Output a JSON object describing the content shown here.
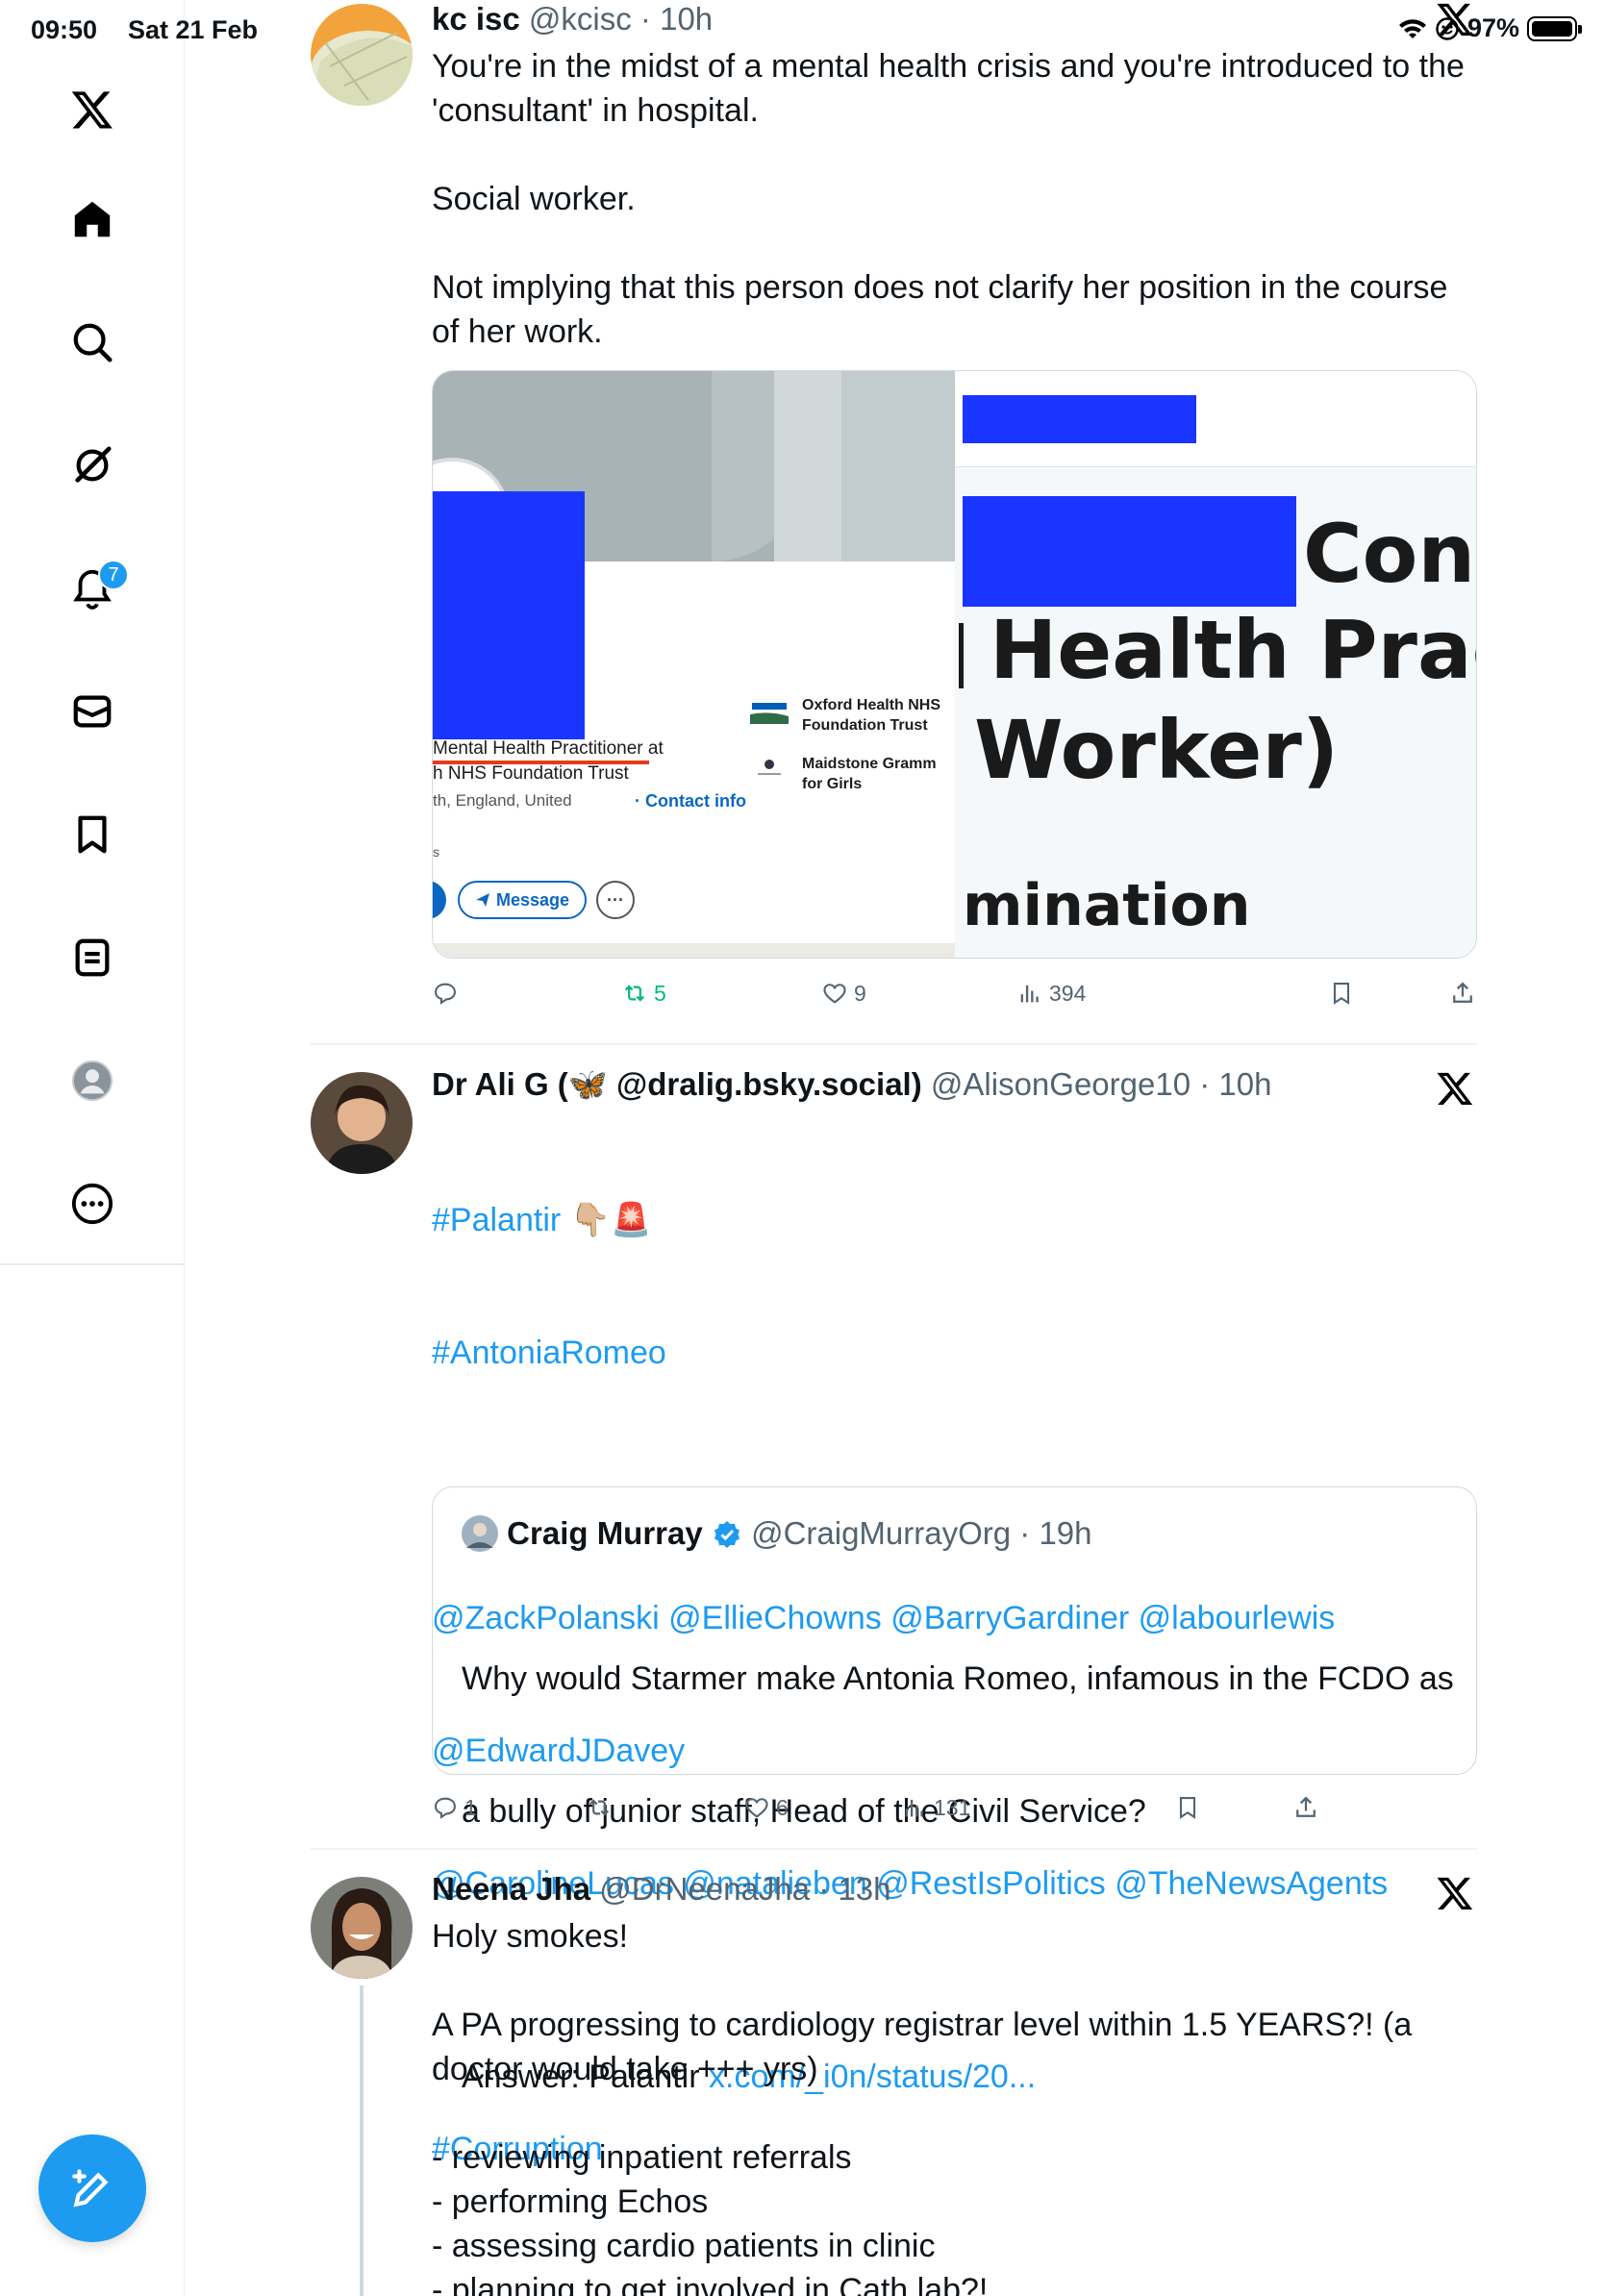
{
  "status_bar": {
    "time": "09:50",
    "date": "Sat 21 Feb",
    "battery": "97%"
  },
  "sidebar": {
    "notification_count": "7",
    "items": [
      "Home",
      "Explore",
      "Grok",
      "Notifications",
      "Messages",
      "Bookmarks",
      "Lists",
      "Profile",
      "More"
    ]
  },
  "tweets": [
    {
      "name": "kc isc",
      "handle": "@kcisc",
      "time": "10h",
      "text": "You're in the midst of a mental health crisis and you're introduced to the 'consultant' in hospital.\n\nSocial worker.\n\nNot implying that this person does not clarify her position in the course of her work.",
      "media": {
        "job_title": "Mental Health Practitioner at",
        "trust": "h NHS Foundation Trust",
        "location": "th, England, United",
        "contact": "Contact info",
        "s_fragment": "s",
        "org1": "Oxford Health NHS Foundation Trust",
        "org1_l1": "Oxford Health NHS",
        "org1_l2": "Foundation Trust",
        "org2_l1": "Maidstone Gramm",
        "org2_l2": "for Girls",
        "message_btn": "Message",
        "more_btn": "···",
        "big_line1": "Cons",
        "big_line2": "Health Pract",
        "big_line3": "Worker)",
        "big_line4": "mination"
      },
      "stats": {
        "replies": "",
        "reposts": "5",
        "likes": "9",
        "views": "394"
      }
    },
    {
      "name": "Dr Ali G (🦋 @dralig.bsky.social)",
      "handle": "@AlisonGeorge10",
      "time": "10h",
      "hashtag1": "#Palantir",
      "emoji": "👇🏼🚨",
      "hashtag2": "#AntoniaRomeo",
      "mentions1": "@ZackPolanski @EllieChowns @BarryGardiner @labourlewis",
      "mentions2": "@EdwardJDavey",
      "mentions3": "@CarolineLucas @natalieben @RestIsPolitics @TheNewsAgents",
      "hashtag3": "#Corruption",
      "quote": {
        "name": "Craig Murray",
        "handle": "@CraigMurrayOrg",
        "time": "19h",
        "text1": "Why would Starmer make Antonia Romeo, infamous in the FCDO as",
        "text2": "a bully of junior staff, Head of the Civil Service?",
        "answer": "Answer: Palantir ",
        "link": "x.com/_i0n/status/20..."
      },
      "stats": {
        "replies": "1",
        "reposts": "",
        "likes": "6",
        "views": "131"
      }
    },
    {
      "name": "Neena Jha",
      "handle": "@DrNeenaJha",
      "time": "13h",
      "text": "Holy smokes!\n\nA PA progressing to cardiology registrar level within 1.5 YEARS?! (a doctor would take +++ yrs)\n\n- reviewing inpatient referrals\n- performing Echos\n- assessing cardio patients in clinic\n- planning to get involved in Cath lab?!"
    }
  ],
  "colors": {
    "accent": "#1d9bf0",
    "repost": "#00ba7c",
    "muted": "#536471",
    "redaction": "#1a35ff"
  }
}
